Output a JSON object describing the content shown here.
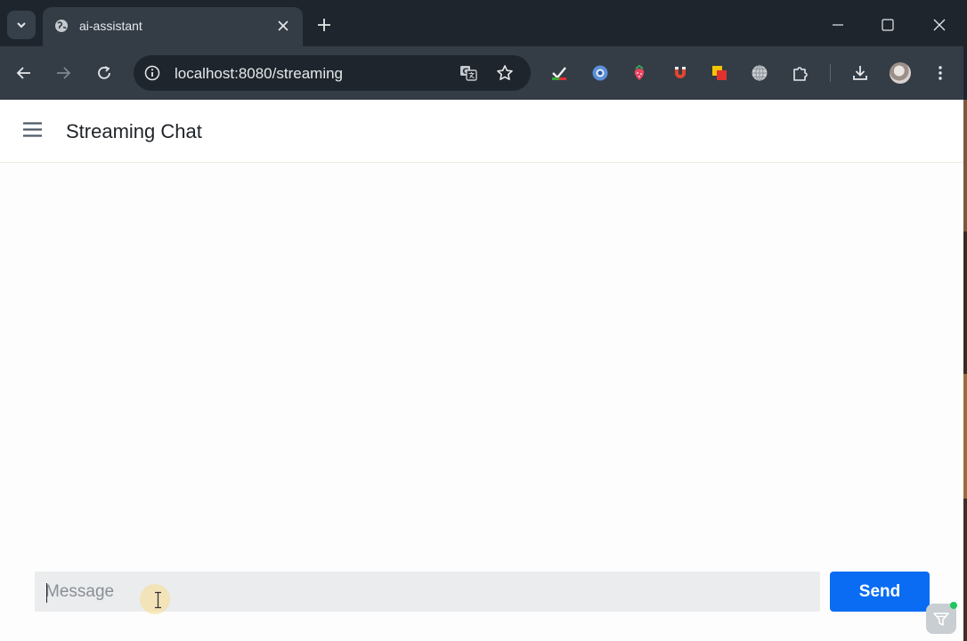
{
  "browser": {
    "tab": {
      "title": "ai-assistant",
      "favicon": "globe-icon"
    },
    "omnibox": {
      "url": "localhost:8080/streaming"
    },
    "icons": {
      "tab_search": "chevron-down-icon",
      "tab_close": "close-icon",
      "new_tab": "plus-icon",
      "minimize": "minimize-icon",
      "maximize": "maximize-icon",
      "window_close": "close-icon",
      "back": "arrow-left-icon",
      "forward": "arrow-right-icon",
      "reload": "reload-icon",
      "site_info": "info-icon",
      "translate": "translate-icon",
      "bookmark": "star-icon",
      "extensions_puzzle": "puzzle-icon",
      "downloads": "download-icon",
      "profile": "avatar",
      "menu": "kebab-menu-icon"
    },
    "colors": {
      "frame": "#1e252d",
      "toolbar": "#343d46"
    }
  },
  "app": {
    "title": "Streaming Chat",
    "menu_icon": "hamburger-icon",
    "input": {
      "placeholder": "Message",
      "value": ""
    },
    "send_label": "Send",
    "colors": {
      "accent": "#0a6cf2",
      "input_bg": "#eaecee"
    }
  }
}
